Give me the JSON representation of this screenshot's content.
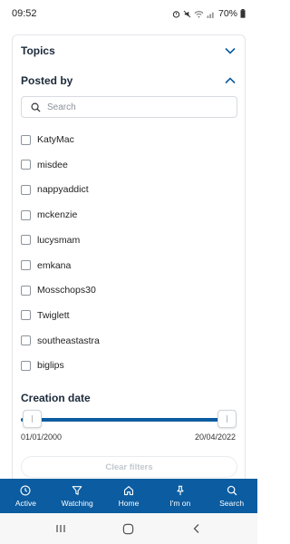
{
  "status_bar": {
    "time": "09:52",
    "battery": "70%"
  },
  "topics": {
    "title": "Topics"
  },
  "posted_by": {
    "title": "Posted by",
    "search_placeholder": "Search",
    "users": [
      "KatyMac",
      "misdee",
      "nappyaddict",
      "mckenzie",
      "lucysmam",
      "emkana",
      "Mosschops30",
      "Twiglett",
      "southeastastra",
      "biglips"
    ]
  },
  "creation_date": {
    "title": "Creation date",
    "start": "01/01/2000",
    "end": "20/04/2022",
    "range_fraction": [
      0.0,
      1.0
    ]
  },
  "clear_filters": "Clear filters",
  "bottom_nav": [
    {
      "label": "Active",
      "icon": "clock-icon"
    },
    {
      "label": "Watching",
      "icon": "filter-icon"
    },
    {
      "label": "Home",
      "icon": "home-icon"
    },
    {
      "label": "I'm on",
      "icon": "pin-icon"
    },
    {
      "label": "Search",
      "icon": "search-icon"
    }
  ],
  "colors": {
    "accent": "#0b5ca0",
    "nav_bg": "#0b5ca0"
  }
}
